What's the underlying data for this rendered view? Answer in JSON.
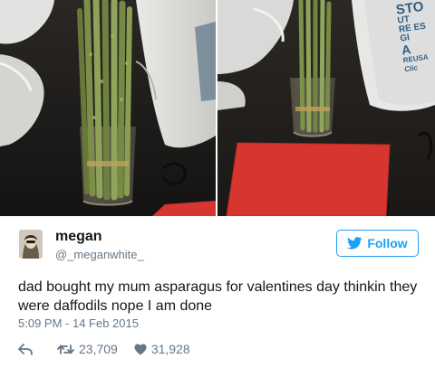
{
  "tweet": {
    "display_name": "megan",
    "handle": "@_meganwhite_",
    "follow_label": "Follow",
    "text": "dad bought my mum asparagus for valentines day thinkin they were daffodils nope I am done",
    "timestamp": "5:09 PM - 14 Feb 2015",
    "retweet_count": "23,709",
    "like_count": "31,928"
  },
  "photo_bag_text": {
    "lines": [
      "STO",
      "UT",
      "RE ES",
      "Gl",
      "A",
      "REUSA",
      "Clic"
    ]
  },
  "icons": {
    "follow": "bird-icon",
    "reply": "reply-arrow-icon",
    "retweet": "retweet-icon",
    "like": "heart-icon"
  },
  "colors": {
    "accent": "#1da1f2",
    "text": "#14171a",
    "muted": "#657786",
    "envelope": "#d7352f"
  }
}
